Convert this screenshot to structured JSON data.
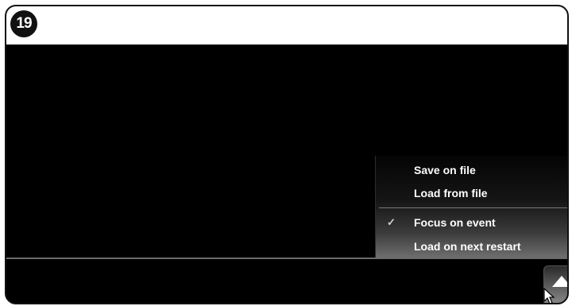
{
  "step_badge": "19",
  "context_menu": {
    "items": [
      {
        "label": "Save on file",
        "checked": false
      },
      {
        "label": "Load from file",
        "checked": false
      },
      {
        "label": "Focus on event",
        "checked": true
      },
      {
        "label": "Load on next restart",
        "checked": false
      }
    ],
    "check_glyph": "✓"
  },
  "menu_toggle": {
    "icon": "triangle-up-icon"
  },
  "cursor": {
    "icon": "mouse-pointer-icon"
  },
  "colors": {
    "screen_bg": "#000000",
    "menu_text": "#ffffff",
    "frame_border": "#111111"
  }
}
